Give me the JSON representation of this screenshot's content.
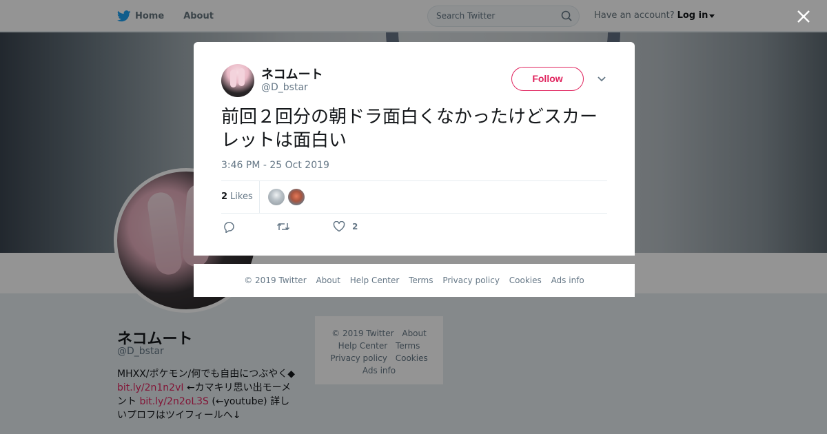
{
  "topbar": {
    "home_label": "Home",
    "about_label": "About",
    "search_placeholder": "Search Twitter",
    "account_prompt": "Have an account?",
    "login_label": "Log in"
  },
  "profile": {
    "name": "ネコムート",
    "handle": "@D_bstar",
    "bio_1": "MHXX/ポケモン/何でも自由につぶやく◆",
    "bio_link_1": "bit.ly/2n1n2vI",
    "bio_2": " ←カマキリ思い出モーメント ",
    "bio_link_2": "bit.ly/2n2oL3S",
    "bio_3": " (←youtube) 詳しいプロフはツイフィールへ↓"
  },
  "side_footer": {
    "copyright": "© 2019 Twitter",
    "about": "About",
    "help": "Help Center",
    "terms": "Terms",
    "privacy": "Privacy policy",
    "cookies": "Cookies",
    "ads": "Ads info"
  },
  "tweet": {
    "author_name": "ネコムート",
    "author_handle": "@D_bstar",
    "follow_label": "Follow",
    "text": "前回２回分の朝ドラ面白くなかったけどスカーレットは面白い",
    "timestamp": "3:46 PM - 25 Oct 2019",
    "likes_count": "2",
    "likes_label": "Likes",
    "like_action_count": "2"
  },
  "modal_footer": {
    "copyright": "© 2019 Twitter",
    "about": "About",
    "help": "Help Center",
    "terms": "Terms",
    "privacy": "Privacy policy",
    "cookies": "Cookies",
    "ads": "Ads info"
  },
  "colors": {
    "twitter_blue": "#1da1f2",
    "accent_pink": "#e0245e",
    "muted_text": "#657786"
  },
  "icons": [
    "twitter-bird-icon",
    "search-icon",
    "close-icon",
    "chevron-down-icon",
    "reply-icon",
    "retweet-icon",
    "heart-icon"
  ]
}
